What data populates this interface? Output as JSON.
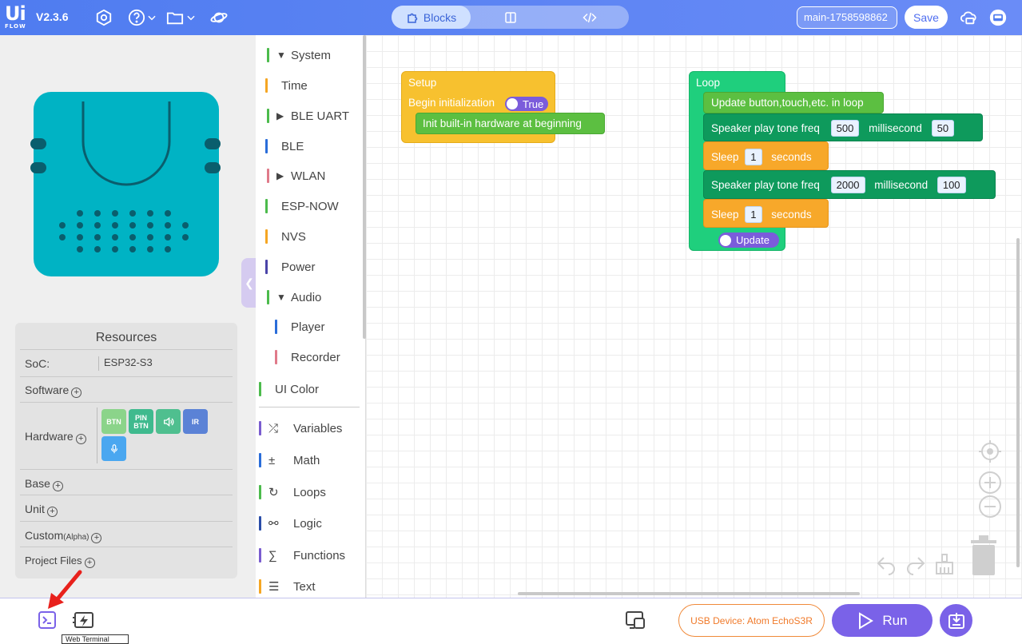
{
  "app": {
    "logo_top": "Ui",
    "logo_bottom": "FLOW",
    "version": "V2.3.6",
    "accent": "#4f7cf0"
  },
  "toolbar": {
    "icons": [
      "settings-hex-icon",
      "help-icon",
      "chevron-down-icon",
      "folder-icon",
      "chevron-down-icon",
      "planet-icon"
    ],
    "tabs": [
      {
        "label": "Blocks",
        "icon": "puzzle-icon",
        "active": true
      },
      {
        "label": "",
        "icon": "split-view-icon",
        "active": false
      },
      {
        "label": "",
        "icon": "code-icon",
        "active": false
      }
    ],
    "filename": "main-1758598862",
    "save_label": "Save",
    "right_icons": [
      "cloud-user-icon",
      "avatar-icon"
    ]
  },
  "resources": {
    "title": "Resources",
    "soc_label": "SoC:",
    "soc_value": "ESP32-S3",
    "software_label": "Software",
    "hardware_label": "Hardware",
    "hardware_chips": [
      {
        "label": "BTN",
        "color": "#8bd48a"
      },
      {
        "label": "PIN BTN",
        "color": "#3fba8e"
      },
      {
        "label": "",
        "icon": "speaker-icon",
        "color": "#4fbf8f"
      },
      {
        "label": "IR",
        "color": "#5b82d6"
      },
      {
        "label": "",
        "icon": "mic-icon",
        "color": "#4aa7f0"
      }
    ],
    "base_label": "Base",
    "unit_label": "Unit",
    "custom_label": "Custom",
    "custom_suffix": "(Alpha)",
    "project_files_label": "Project Files"
  },
  "categories": [
    {
      "label": "System",
      "color": "#4cbb4c",
      "expander": "▼"
    },
    {
      "label": "Time",
      "color": "#f5a623"
    },
    {
      "label": "BLE UART",
      "color": "#4cbb4c",
      "expander": "▶"
    },
    {
      "label": "BLE",
      "color": "#2a6dd9"
    },
    {
      "label": "WLAN",
      "color": "#e07a8a",
      "expander": "▶"
    },
    {
      "label": "ESP-NOW",
      "color": "#4cbb4c"
    },
    {
      "label": "NVS",
      "color": "#f5a623"
    },
    {
      "label": "Power",
      "color": "#4a44a8"
    },
    {
      "label": "Audio",
      "color": "#4cbb4c",
      "expander": "▼"
    },
    {
      "label": "Player",
      "color": "#2a6dd9"
    },
    {
      "label": "Recorder",
      "color": "#e07a8a"
    },
    {
      "label": "UI Color",
      "color": "#4cbb4c"
    },
    {
      "label": "Variables",
      "color": "#7a5ccf",
      "icon": "shuffle-icon"
    },
    {
      "label": "Math",
      "color": "#2a6dd9",
      "icon": "math-icon"
    },
    {
      "label": "Loops",
      "color": "#4cbb4c",
      "icon": "loop-icon"
    },
    {
      "label": "Logic",
      "color": "#2a4da8",
      "icon": "logic-icon"
    },
    {
      "label": "Functions",
      "color": "#7a5ccf",
      "icon": "sigma-icon"
    },
    {
      "label": "Text",
      "color": "#f5a623",
      "icon": "text-icon"
    }
  ],
  "blocks": {
    "setup": {
      "title": "Setup",
      "begin_label": "Begin initialization",
      "begin_value": "True",
      "init_label": "Init built-in hardware at beginning",
      "color": "#f7c12f"
    },
    "loop": {
      "title": "Loop",
      "update_label": "Update button,touch,etc. in loop",
      "tone1_label": "Speaker play tone freq",
      "tone1_freq": "500",
      "tone1_ms_label": "millisecond",
      "tone1_ms": "50",
      "sleep1_label": "Sleep",
      "sleep1_value": "1",
      "sleep1_unit": "seconds",
      "tone2_label": "Speaker play tone freq",
      "tone2_freq": "2000",
      "tone2_ms_label": "millisecond",
      "tone2_ms": "100",
      "sleep2_label": "Sleep",
      "sleep2_value": "1",
      "sleep2_unit": "seconds",
      "update_toggle": "Update",
      "color": "#1fcf7d"
    }
  },
  "bottom": {
    "usb_device": "USB Device: Atom EchoS3R",
    "run_label": "Run",
    "tooltip": "Web Terminal"
  }
}
